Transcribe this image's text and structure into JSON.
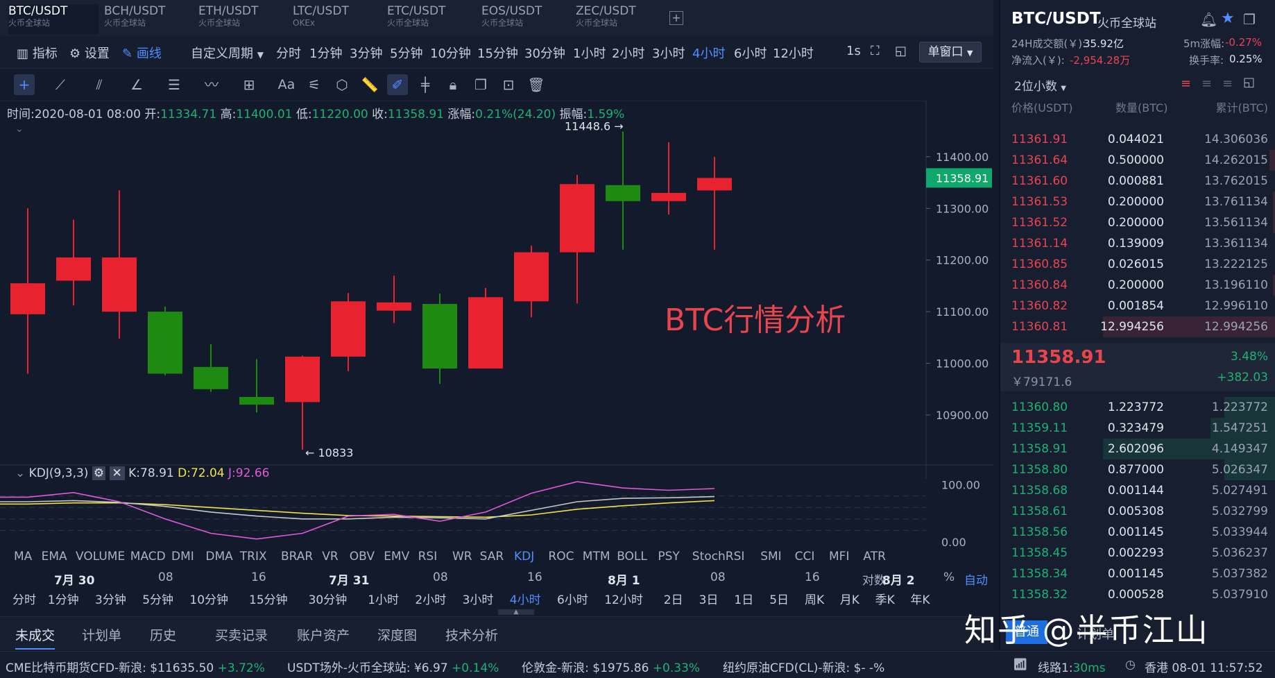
{
  "tabs": [
    {
      "name": "BTC/USDT",
      "sub": "火币全球站"
    },
    {
      "name": "BCH/USDT",
      "sub": "火币全球站"
    },
    {
      "name": "ETH/USDT",
      "sub": "火币全球站"
    },
    {
      "name": "LTC/USDT",
      "sub": "OKEx"
    },
    {
      "name": "ETC/USDT",
      "sub": "火币全球站"
    },
    {
      "name": "EOS/USDT",
      "sub": "火币全球站"
    },
    {
      "name": "ZEC/USDT",
      "sub": "火币全球站"
    }
  ],
  "tab_add": "+",
  "toolbar": {
    "indicator": "指标",
    "settings": "设置",
    "draw": "画线",
    "custom_period": "自定义周期",
    "interval_1s": "1s",
    "window_mode": "单窗口"
  },
  "periods": [
    "分时",
    "1分钟",
    "3分钟",
    "5分钟",
    "10分钟",
    "15分钟",
    "30分钟",
    "1小时",
    "2小时",
    "3小时",
    "4小时",
    "6小时",
    "12小时"
  ],
  "active_period": "4小时",
  "drawing_tools": {
    "text_tool": "Aa"
  },
  "ohlc": {
    "time_label": "时间:",
    "time": "2020-08-01 08:00",
    "open_label": "开:",
    "open": "11334.71",
    "high_label": "高:",
    "high": "11400.01",
    "low_label": "低:",
    "low": "11220.00",
    "close_label": "收:",
    "close": "11358.91",
    "change_label": "涨幅:",
    "change": "0.21%(24.20)",
    "amp_label": "振幅:",
    "amp": "1.59%"
  },
  "chart_data": {
    "type": "candlestick",
    "annotation": "BTC行情分析",
    "high_marker": "11448.6 →",
    "low_marker": "← 10833",
    "current_price": "11358.91",
    "y_ticks": [
      "11400.00",
      "11300.00",
      "11200.00",
      "11100.00",
      "11000.00",
      "10900.00"
    ],
    "ylim": [
      10810,
      11475
    ],
    "candles": [
      {
        "o": 11095,
        "h": 11300,
        "l": 10980,
        "c": 11155
      },
      {
        "o": 11160,
        "h": 11278,
        "l": 11112,
        "c": 11205
      },
      {
        "o": 11100,
        "h": 11335,
        "l": 11048,
        "c": 11205
      },
      {
        "o": 11100,
        "h": 11110,
        "l": 10977,
        "c": 10980
      },
      {
        "o": 10993,
        "h": 11037,
        "l": 10945,
        "c": 10950
      },
      {
        "o": 10935,
        "h": 11008,
        "l": 10905,
        "c": 10920
      },
      {
        "o": 10925,
        "h": 11015,
        "l": 10833,
        "c": 11013
      },
      {
        "o": 11013,
        "h": 11136,
        "l": 10985,
        "c": 11120
      },
      {
        "o": 11102,
        "h": 11170,
        "l": 11078,
        "c": 11118
      },
      {
        "o": 11115,
        "h": 11135,
        "l": 10960,
        "c": 10990
      },
      {
        "o": 10990,
        "h": 11146,
        "l": 10990,
        "c": 11128
      },
      {
        "o": 11120,
        "h": 11228,
        "l": 11089,
        "c": 11215
      },
      {
        "o": 11215,
        "h": 11365,
        "l": 11116,
        "c": 11347
      },
      {
        "o": 11345,
        "h": 11448.6,
        "l": 11220,
        "c": 11314
      },
      {
        "o": 11314,
        "h": 11428,
        "l": 11288,
        "c": 11330
      },
      {
        "o": 11334.71,
        "h": 11400.01,
        "l": 11220,
        "c": 11358.91
      }
    ],
    "kdj": {
      "label": "KDJ(9,3,3)",
      "k_label": "K:",
      "k": "78.91",
      "d_label": "D:",
      "d": "72.04",
      "j_label": "J:",
      "j": "92.66",
      "y_ticks": [
        "100.00",
        "0.00"
      ],
      "ylim": [
        -5,
        110
      ],
      "K": [
        70,
        72,
        69,
        62,
        52,
        45,
        40,
        40,
        43,
        42,
        40,
        55,
        70,
        76,
        77,
        79
      ],
      "D": [
        66,
        68,
        68,
        65,
        60,
        55,
        50,
        46,
        45,
        44,
        43,
        47,
        57,
        63,
        68,
        72
      ],
      "J": [
        78,
        86,
        70,
        40,
        15,
        5,
        15,
        45,
        48,
        36,
        52,
        85,
        105,
        94,
        90,
        93
      ]
    }
  },
  "indicators": [
    "MA",
    "EMA",
    "VOLUME",
    "MACD",
    "DMI",
    "DMA",
    "TRIX",
    "BRAR",
    "VR",
    "OBV",
    "EMV",
    "RSI",
    "WR",
    "SAR",
    "KDJ",
    "ROC",
    "MTM",
    "BOLL",
    "PSY",
    "StochRSI",
    "SMI",
    "CCI",
    "MFI",
    "ATR"
  ],
  "active_indicator": "KDJ",
  "time_axis": {
    "labels": [
      "7月 30",
      "08",
      "16",
      "7月 31",
      "08",
      "16",
      "8月 1",
      "08",
      "16",
      "8月 2"
    ],
    "log": "对数",
    "percent": "%",
    "auto": "自动"
  },
  "periods2": [
    "分时",
    "1分钟",
    "3分钟",
    "5分钟",
    "10分钟",
    "15分钟",
    "30分钟",
    "1小时",
    "2小时",
    "3小时",
    "4小时",
    "6小时",
    "12小时",
    "2日",
    "3日",
    "1日",
    "5日",
    "周K",
    "月K",
    "季K",
    "年K"
  ],
  "bottom_tabs": [
    "未成交",
    "计划单",
    "历史",
    "买卖记录",
    "账户资产",
    "深度图",
    "技术分析"
  ],
  "right_panel": {
    "pair": "BTC/USDT",
    "exchange": "火币全球站",
    "vol_label": "24H成交额(￥):",
    "vol": "35.92亿",
    "flow_label": "净流入(￥):",
    "flow": "-2,954.28万",
    "change5m_label": "5m涨幅:",
    "change5m": "-0.27%",
    "turnover_label": "换手率:",
    "turnover": "0.25%",
    "decimals": "2位小数",
    "headers": [
      "价格(USDT)",
      "数量(BTC)",
      "累计(BTC)"
    ],
    "asks": [
      {
        "p": "11361.91",
        "q": "0.044021",
        "c": "14.306036",
        "w": 0.01
      },
      {
        "p": "11361.64",
        "q": "0.500000",
        "c": "14.262015",
        "w": 0.04
      },
      {
        "p": "11361.60",
        "q": "0.000881",
        "c": "13.762015",
        "w": 0.01
      },
      {
        "p": "11361.53",
        "q": "0.200000",
        "c": "13.761134",
        "w": 0.02
      },
      {
        "p": "11361.52",
        "q": "0.200000",
        "c": "13.561134",
        "w": 0.02
      },
      {
        "p": "11361.14",
        "q": "0.139009",
        "c": "13.361134",
        "w": 0.01
      },
      {
        "p": "11360.85",
        "q": "0.026015",
        "c": "13.222125",
        "w": 0.01
      },
      {
        "p": "11360.84",
        "q": "0.200000",
        "c": "13.196110",
        "w": 0.02
      },
      {
        "p": "11360.82",
        "q": "0.001854",
        "c": "12.996110",
        "w": 0.01
      },
      {
        "p": "11360.81",
        "q": "12.994256",
        "c": "12.994256",
        "w": 1.0
      }
    ],
    "last_price": "11358.91",
    "last_change": "3.48%",
    "cny_price": "￥79171.6",
    "last_delta": "+382.03",
    "bids": [
      {
        "p": "11360.80",
        "q": "1.223772",
        "c": "1.223772",
        "w": 0.3
      },
      {
        "p": "11359.11",
        "q": "0.323479",
        "c": "1.547251",
        "w": 0.38
      },
      {
        "p": "11358.91",
        "q": "2.602096",
        "c": "4.149347",
        "w": 1.0
      },
      {
        "p": "11358.80",
        "q": "0.877000",
        "c": "5.026347",
        "w": 0.3
      },
      {
        "p": "11358.68",
        "q": "0.001144",
        "c": "5.027491",
        "w": 0.01
      },
      {
        "p": "11358.61",
        "q": "0.005308",
        "c": "5.032799",
        "w": 0.01
      },
      {
        "p": "11358.56",
        "q": "0.001145",
        "c": "5.033944",
        "w": 0.01
      },
      {
        "p": "11358.45",
        "q": "0.002293",
        "c": "5.036237",
        "w": 0.01
      },
      {
        "p": "11358.34",
        "q": "0.001145",
        "c": "5.037382",
        "w": 0.01
      },
      {
        "p": "11358.32",
        "q": "0.000528",
        "c": "5.037910",
        "w": 0.01
      }
    ],
    "tabs": [
      "普通",
      "计划单"
    ]
  },
  "statusbar": {
    "i1_label": "CME比特币期货CFD-新浪:",
    "i1_val": "$11635.50",
    "i1_chg": "+3.72%",
    "i2_label": "USDT场外-火币全球站:",
    "i2_val": "¥6.97",
    "i2_chg": "+0.14%",
    "i3_label": "伦敦金-新浪:",
    "i3_val": "$1975.86",
    "i3_chg": "+0.33%",
    "i4_label": "纽约原油CFD(CL)-新浪:",
    "i4_val": "$- -%",
    "line_label": "线路1:",
    "line_ms": "30ms",
    "clock": "香港 08-01 11:57:52"
  },
  "watermark": "知乎 @半币江山",
  "colors": {
    "up": "#e8232f",
    "down": "#1e8a12",
    "k": "#c8c8c8",
    "d": "#f0e24a",
    "j": "#e05ad8",
    "accent": "#4f8fff"
  }
}
